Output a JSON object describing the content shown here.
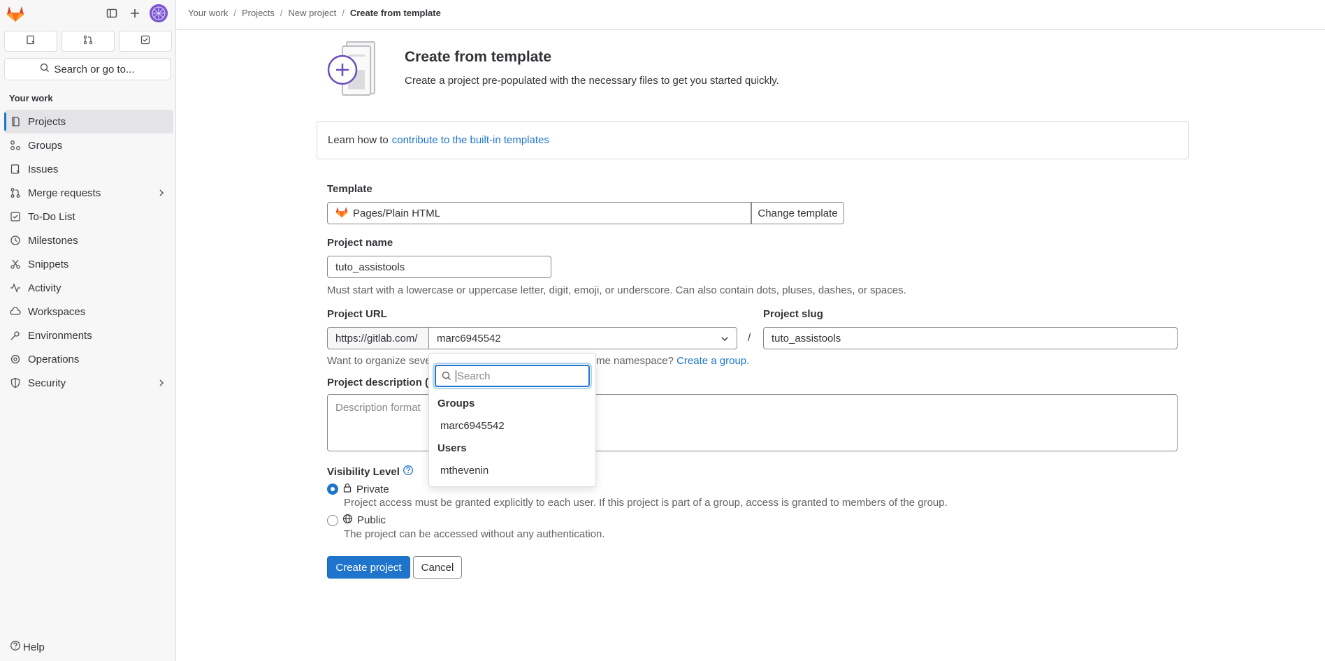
{
  "sidebar": {
    "search_label": "Search or go to...",
    "section_title": "Your work",
    "items": [
      {
        "label": "Projects"
      },
      {
        "label": "Groups"
      },
      {
        "label": "Issues"
      },
      {
        "label": "Merge requests"
      },
      {
        "label": "To-Do List"
      },
      {
        "label": "Milestones"
      },
      {
        "label": "Snippets"
      },
      {
        "label": "Activity"
      },
      {
        "label": "Workspaces"
      },
      {
        "label": "Environments"
      },
      {
        "label": "Operations"
      },
      {
        "label": "Security"
      }
    ],
    "help_label": "Help"
  },
  "breadcrumb": [
    "Your work",
    "Projects",
    "New project",
    "Create from template"
  ],
  "header": {
    "title": "Create from template",
    "subtitle": "Create a project pre-populated with the necessary files to get you started quickly."
  },
  "info": {
    "text": "Learn how to",
    "link": "contribute to the built-in templates"
  },
  "template": {
    "label": "Template",
    "value": "Pages/Plain HTML",
    "change_button": "Change template"
  },
  "project_name": {
    "label": "Project name",
    "value": "tuto_assistools",
    "help": "Must start with a lowercase or uppercase letter, digit, emoji, or underscore. Can also contain dots, pluses, dashes, or spaces."
  },
  "project_url": {
    "label": "Project URL",
    "prefix": "https://gitlab.com/",
    "namespace": "marc6945542",
    "separator": "/",
    "help_visible_start": "Want to organize seve",
    "help_visible_end": "me namespace?",
    "help_link": "Create a group."
  },
  "project_slug": {
    "label": "Project slug",
    "value": "tuto_assistools"
  },
  "description": {
    "label": "Project description (o",
    "placeholder": "Description format"
  },
  "visibility": {
    "label": "Visibility Level",
    "options": [
      {
        "label": "Private",
        "desc": "Project access must be granted explicitly to each user. If this project is part of a group, access is granted to members of the group.",
        "checked": true
      },
      {
        "label": "Public",
        "desc": "The project can be accessed without any authentication.",
        "checked": false
      }
    ]
  },
  "actions": {
    "create": "Create project",
    "cancel": "Cancel"
  },
  "dropdown": {
    "search_placeholder": "Search",
    "groups_header": "Groups",
    "groups": [
      "marc6945542"
    ],
    "users_header": "Users",
    "users": [
      "mthevenin"
    ]
  },
  "colors": {
    "accent": "#1f75cb",
    "brand": "#e24329"
  }
}
